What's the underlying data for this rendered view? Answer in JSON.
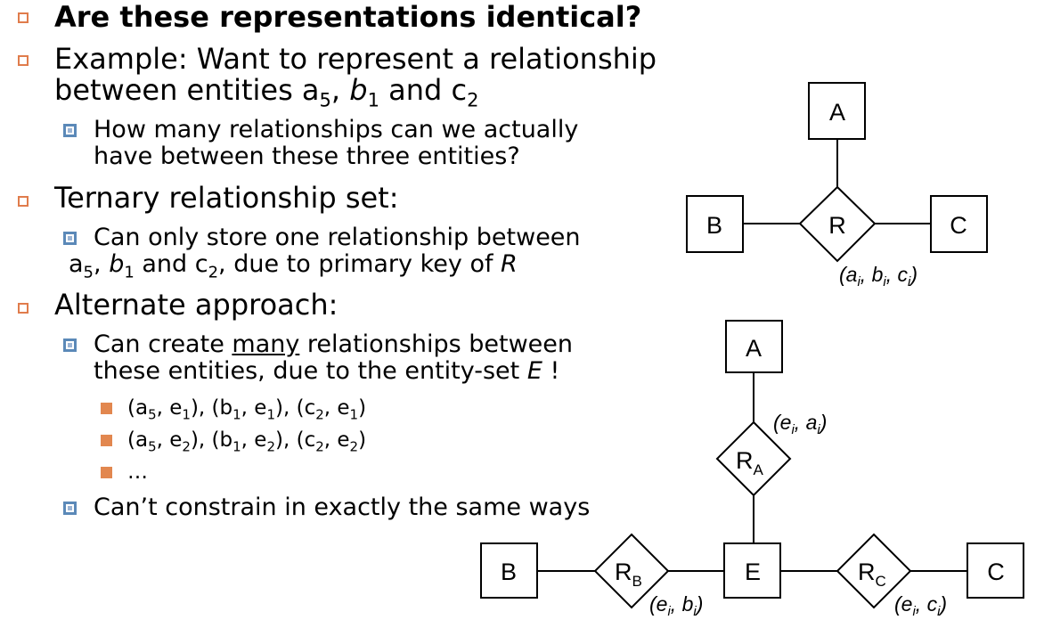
{
  "slide": {
    "bullet1": "Are these representations identical?",
    "bullet2_line1": "Example:  Want to represent a relationship",
    "bullet2_line2_pre": "between entities ",
    "bullet2_line2_post": " and c",
    "sub1_line1": "How many relationships can we actually",
    "sub1_line2": "have between these three entities?",
    "bullet3": "Ternary relationship set:",
    "sub2_line1": "Can only store one relationship between",
    "sub2_line2_mid": " and c",
    "sub2_line2_tail": ", due to primary key of ",
    "sub2_line2_r": "R",
    "bullet4": "Alternate approach:",
    "sub3_line1_pre": "Can create ",
    "sub3_line1_u": "many",
    "sub3_line1_post": " relationships between",
    "sub3_line2_pre": "these entities, due to the entity-set ",
    "sub3_line2_e": "E",
    "sub3_line2_post": " !",
    "subsub1": "(a5, e1), (b1, e1), (c2, e1)",
    "subsub2": "(a5, e2), (b1, e2), (c2, e2)",
    "subsub3": "…",
    "sub4": "Can’t constrain in exactly the same ways"
  },
  "symbols": {
    "a": "a",
    "b": "b",
    "c": "c",
    "e": "e",
    "i": "i",
    "one": "1",
    "two": "2",
    "five": "5",
    "comma": ",",
    "lp": "(",
    "rp": ")",
    "sep": ", "
  },
  "diagram_top": {
    "entity_a": "A",
    "entity_b": "B",
    "entity_c": "C",
    "relation": "R"
  },
  "diagram_bottom": {
    "entity_a": "A",
    "entity_b": "B",
    "entity_c": "C",
    "entity_e": "E",
    "rel_letter": "R",
    "sub_a": "A",
    "sub_b": "B",
    "sub_c": "C"
  },
  "colors": {
    "level1_bullet": "#E07C4C",
    "level2_bullet": "#5B89B8",
    "level3_bullet": "#E2874F"
  }
}
